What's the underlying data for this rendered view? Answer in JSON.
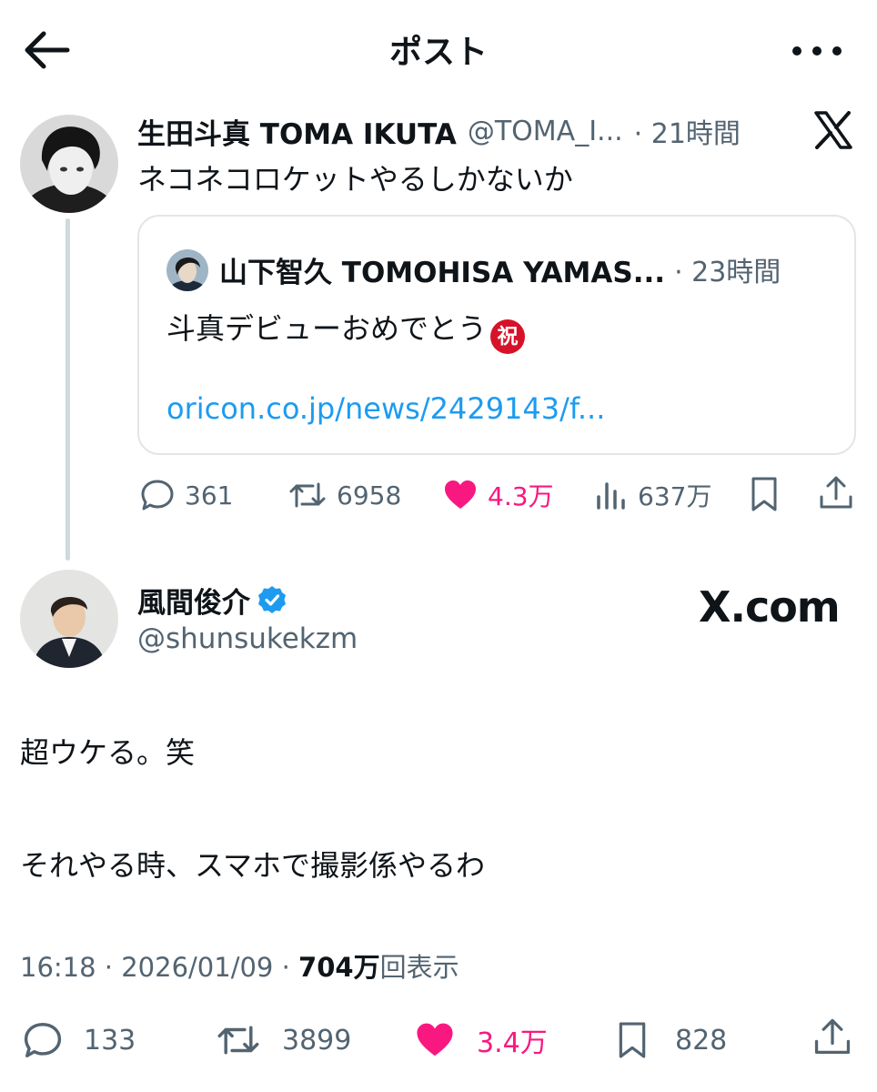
{
  "header": {
    "title": "ポスト",
    "back_icon": "arrow-left-icon",
    "more_icon": "more-horizontal-icon"
  },
  "post": {
    "author_name": "生田斗真 TOMA IKUTA",
    "handle": "@TOMA_I...",
    "time": "· 21時間",
    "platform_icon": "x-logo-icon",
    "text": "ネコネコロケットやるしかないか",
    "quote": {
      "author_name": "山下智久 TOMOHISA YAMAS...",
      "time": "· 23時間",
      "text": "斗真デビューおめでとう",
      "emoji": "祝",
      "link": "oricon.co.jp/news/2429143/f..."
    },
    "actions": {
      "replies": "361",
      "reposts": "6958",
      "likes": "4.3万",
      "views": "637万"
    }
  },
  "reply": {
    "author_name": "風間俊介",
    "handle": "@shunsukekzm",
    "verified": true,
    "source_label": "X.com",
    "text_line1": "超ウケる。笑",
    "text_line2": "それやる時、スマホで撮影係やるわ",
    "meta_time": "16:18 · 2026/01/09 · ",
    "meta_views": "704万",
    "meta_views_suffix": "回表示",
    "actions": {
      "replies": "133",
      "reposts": "3899",
      "likes": "3.4万",
      "bookmarks": "828"
    }
  },
  "colors": {
    "accent": "#1d9bf0",
    "like": "#f91880",
    "secondary": "#536471",
    "border": "#cfd9de"
  }
}
